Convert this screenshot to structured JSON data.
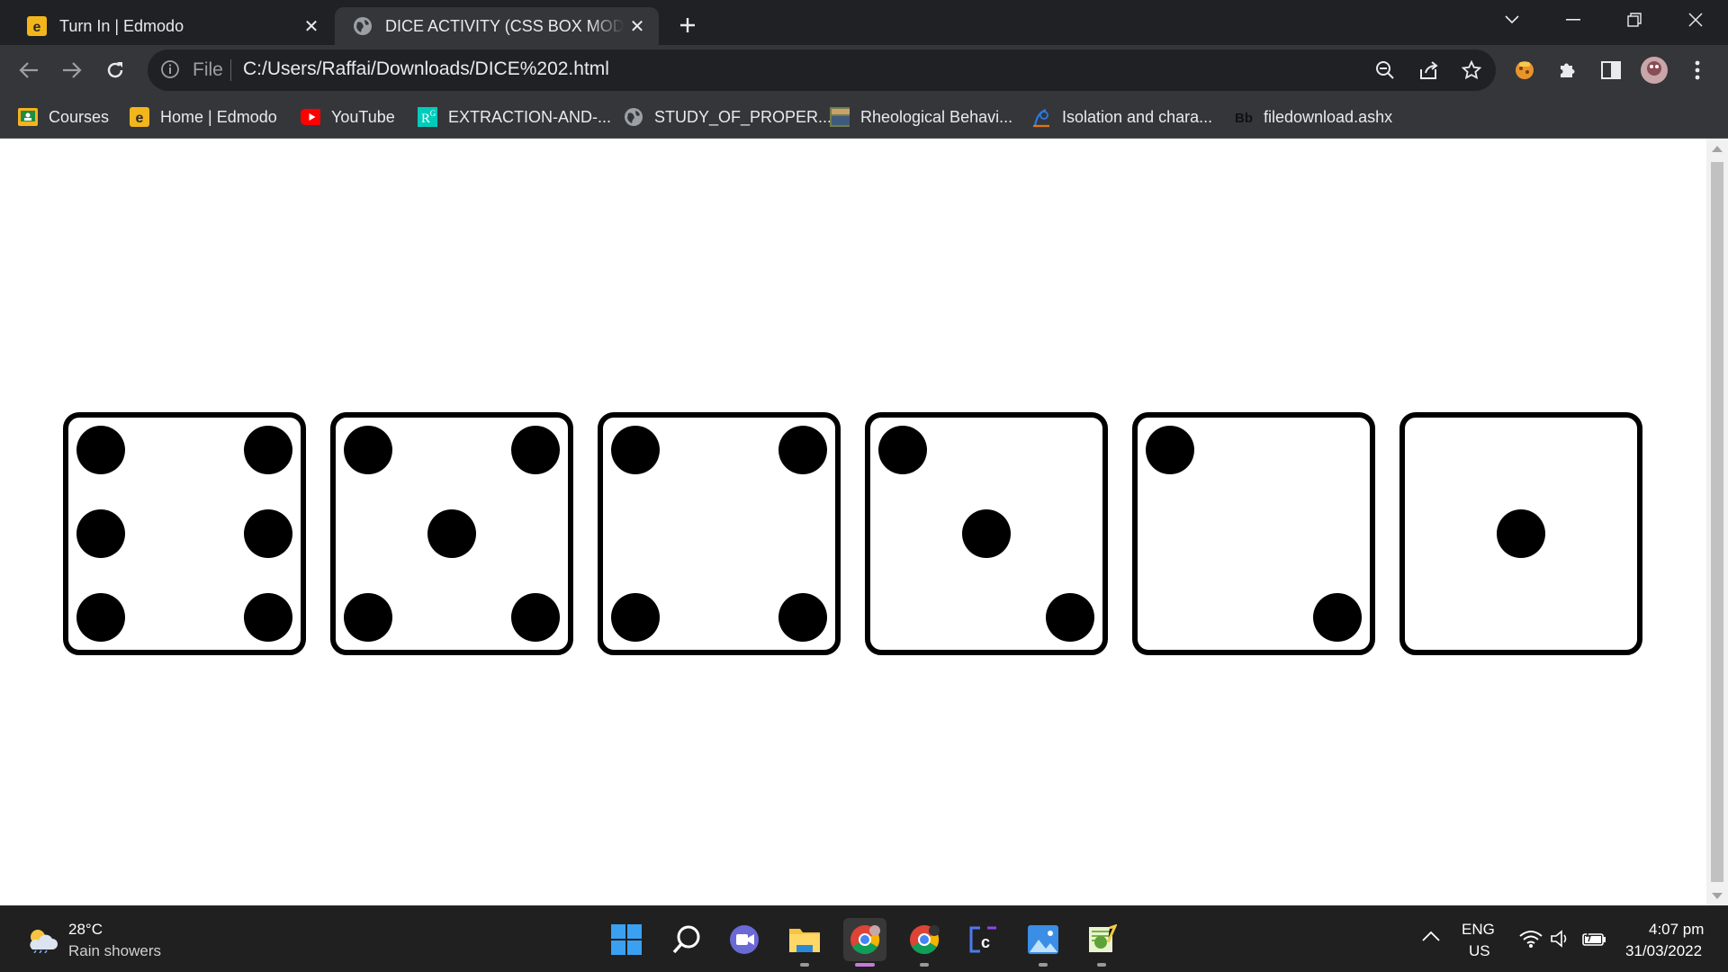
{
  "tabs": [
    {
      "title": "Turn In | Edmodo",
      "favicon": "edmodo-icon",
      "active": false
    },
    {
      "title": "DICE ACTIVITY (CSS BOX MODEL)",
      "favicon": "globe-icon",
      "active": true
    }
  ],
  "toolbar": {
    "file_label": "File",
    "url": "C:/Users/Raffai/Downloads/DICE%202.html"
  },
  "bookmarks": [
    {
      "label": "Courses",
      "icon": "classroom-icon"
    },
    {
      "label": "Home | Edmodo",
      "icon": "edmodo-icon"
    },
    {
      "label": "YouTube",
      "icon": "youtube-icon"
    },
    {
      "label": "EXTRACTION-AND-...",
      "icon": "researchgate-icon"
    },
    {
      "label": "STUDY_OF_PROPER...",
      "icon": "globe-icon"
    },
    {
      "label": "Rheological Behavi...",
      "icon": "journal-icon"
    },
    {
      "label": "Isolation and chara...",
      "icon": "sciencedirect-icon"
    },
    {
      "label": "filedownload.ashx",
      "icon": "blackboard-icon"
    }
  ],
  "dice": [
    {
      "face": 6
    },
    {
      "face": 5
    },
    {
      "face": 4
    },
    {
      "face": 3
    },
    {
      "face": 2
    },
    {
      "face": 1
    }
  ],
  "taskbar": {
    "weather": {
      "temp": "28°C",
      "desc": "Rain showers"
    },
    "apps": [
      "start-icon",
      "search-icon",
      "chat-icon",
      "file-explorer-icon",
      "chrome-icon",
      "chrome-profile-icon",
      "code-icon",
      "photos-icon",
      "notepad-icon"
    ],
    "lang_top": "ENG",
    "lang_bottom": "US",
    "time": "4:07 pm",
    "date": "31/03/2022"
  },
  "colors": {
    "chrome_dark": "#202124",
    "chrome_toolbar": "#35363a",
    "taskbar": "#202020",
    "pip": "#000000"
  }
}
